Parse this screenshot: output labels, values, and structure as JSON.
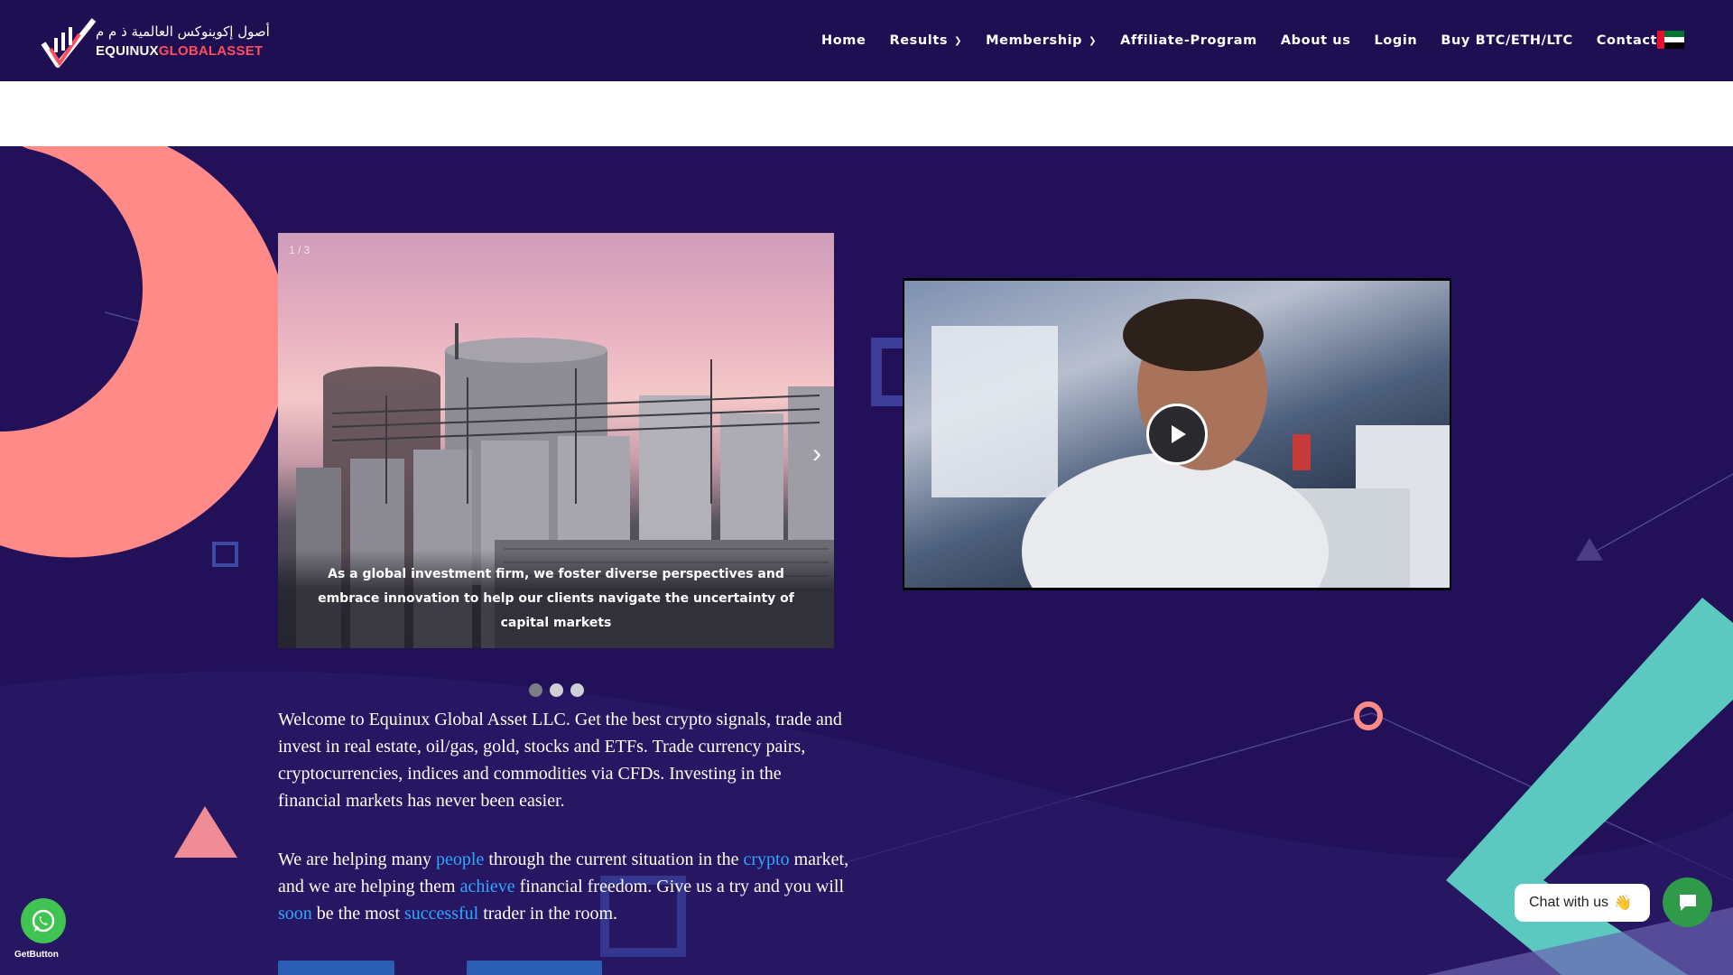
{
  "header": {
    "logo": {
      "arabic": "أصول إكوينوكس العالمية ذ م م",
      "name_part1": "EQUINUX",
      "name_part2": "GLOBALASSET"
    },
    "nav": [
      {
        "label": "Home",
        "dropdown": false
      },
      {
        "label": "Results",
        "dropdown": true
      },
      {
        "label": "Membership",
        "dropdown": true
      },
      {
        "label": "Affiliate-Program",
        "dropdown": false
      },
      {
        "label": "About us",
        "dropdown": false
      },
      {
        "label": "Login",
        "dropdown": false
      },
      {
        "label": "Buy BTC/ETH/LTC",
        "dropdown": false
      },
      {
        "label": "Contact",
        "dropdown": false
      }
    ],
    "flag": "uae-flag"
  },
  "slider": {
    "counter": "1 / 3",
    "caption": "As a global investment firm, we foster diverse perspectives and embrace innovation to help our clients navigate the uncertainty of capital markets",
    "next_icon": "›",
    "total_slides": 3,
    "active_slide": 1
  },
  "video": {
    "play_icon": "play-icon"
  },
  "intro": {
    "paragraph1": "Welcome to Equinux Global Asset LLC. Get the best crypto signals, trade and invest in real estate, oil/gas, gold, stocks and ETFs. Trade currency pairs, cryptocurrencies, indices and commodities via CFDs. Investing in the financial markets has never been easier.",
    "p2": {
      "t1": "We are helping many ",
      "l1": "people",
      "t2": " through the current situation in the ",
      "l2": "crypto",
      "t3": " market, and we are helping them ",
      "l3": "achieve",
      "t4": " financial freedom. Give us a try and you will ",
      "l4": "soon",
      "t5": " be the most ",
      "l5": "successful",
      "t6": " trader in the room."
    }
  },
  "widgets": {
    "whatsapp_icon": "whatsapp-icon",
    "getbutton_label": "GetButton",
    "chat_label": "Chat with us",
    "chat_emoji": "👋",
    "chat_icon": "chat-icon"
  },
  "colors": {
    "background": "#221159",
    "header": "#1d0f52",
    "accent_red": "#ff4d5e",
    "link": "#2ea8ff",
    "coral": "#ff8a87",
    "teal": "#5cc9c0"
  }
}
